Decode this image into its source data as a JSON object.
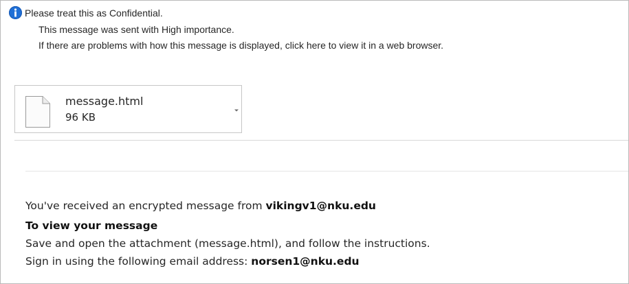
{
  "infobar": {
    "line1": "Please treat this as Confidential.",
    "line2": "This message was sent with High importance.",
    "line3": "If there are problems with how this message is displayed, click here to view it in a web browser.",
    "icon": "info-icon",
    "icon_color": "#1f6fd6"
  },
  "attachment": {
    "name": "message.html",
    "size": "96 KB",
    "icon": "file-icon",
    "dropdown_icon": "chevron-down-icon"
  },
  "message": {
    "line1_prefix": "You've received an encrypted message from ",
    "sender": "vikingv1@nku.edu",
    "heading": "To view your message",
    "instructions": "Save and open the attachment (message.html), and follow the instructions.",
    "signin_prefix": "Sign in using the following email address: ",
    "recipient": "norsen1@nku.edu"
  }
}
